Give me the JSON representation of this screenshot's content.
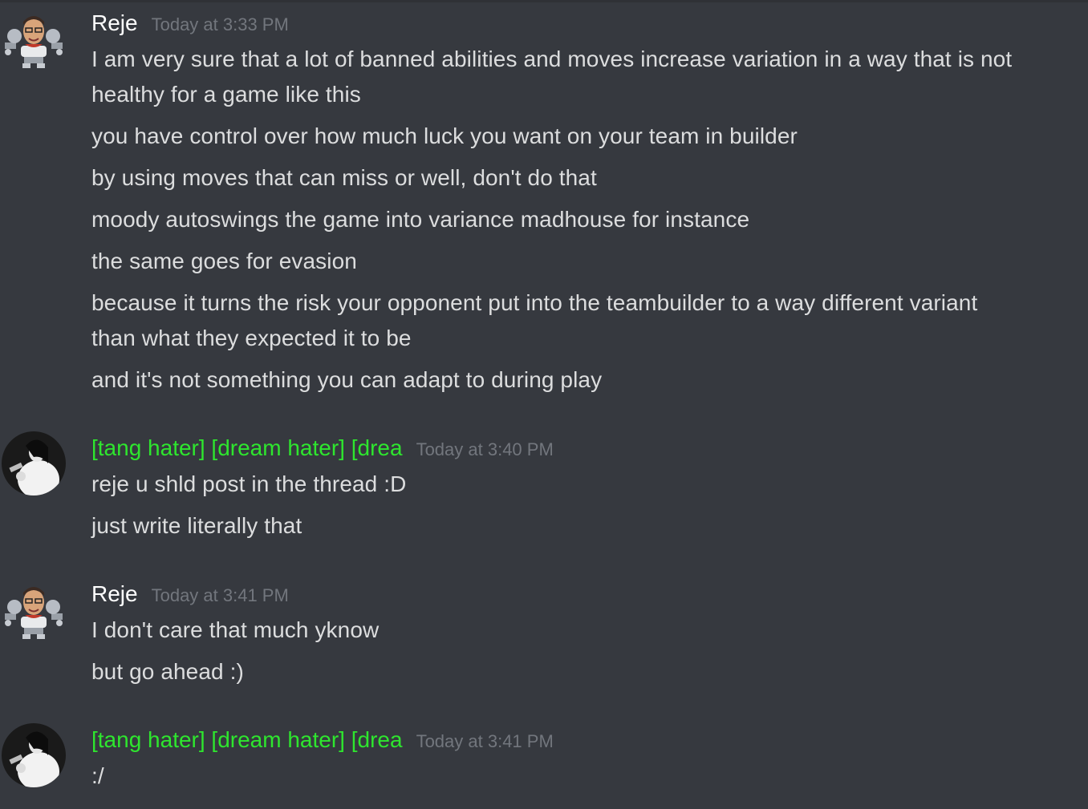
{
  "messages": [
    {
      "author": "Reje",
      "author_color": "#ffffff",
      "avatar": "robot-avatar",
      "time": "Today at 3:33 PM",
      "lines": [
        "I am very sure that a lot of banned abilities and moves increase variation in a way that is not healthy for a game like this",
        "you have control over how much luck you want on your team in builder",
        "by using moves that can miss or well, don't do that",
        "moody autoswings the game into variance madhouse for instance",
        "the same goes for evasion",
        "because it turns the risk your opponent put into the teambuilder to a way different variant than what they expected it to be",
        "and it's not something you can adapt to during play"
      ]
    },
    {
      "author": "[tang hater] [dream hater] [drea",
      "author_color": "#2ee62e",
      "avatar": "photo-avatar",
      "time": "Today at 3:40 PM",
      "lines": [
        "reje u shld post in the thread :D",
        "just write literally that"
      ]
    },
    {
      "author": "Reje",
      "author_color": "#ffffff",
      "avatar": "robot-avatar",
      "time": "Today at 3:41 PM",
      "lines": [
        "I don't care that much yknow",
        "but go ahead :)"
      ]
    },
    {
      "author": "[tang hater] [dream hater] [drea",
      "author_color": "#2ee62e",
      "avatar": "photo-avatar",
      "time": "Today at 3:41 PM",
      "lines": [
        ":/"
      ]
    }
  ]
}
